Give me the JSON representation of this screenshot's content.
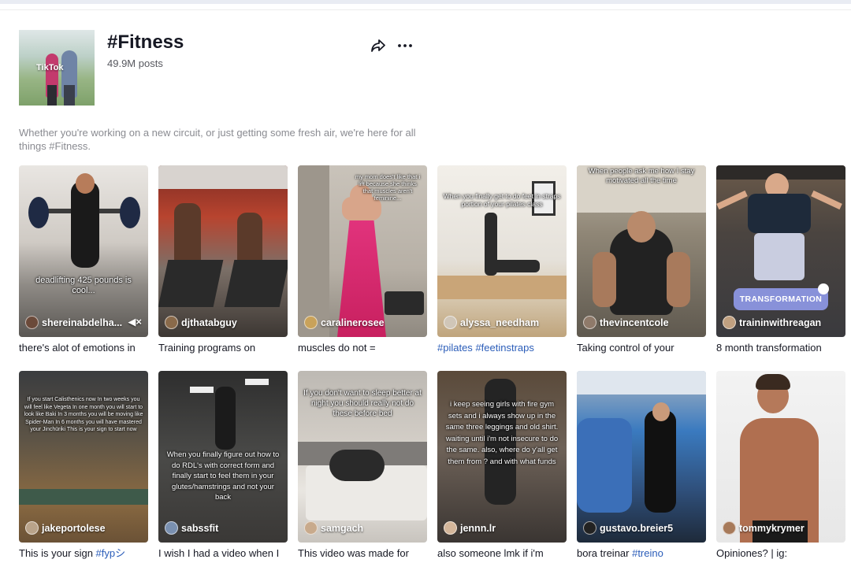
{
  "tag": {
    "title": "#Fitness",
    "posts": "49.9M posts",
    "description": "Whether you're working on a new circuit, or just getting some fresh air, we're here for all things #Fitness.",
    "cover_watermark": "TikTok"
  },
  "icons": {
    "share": "share-icon",
    "more": "more-icon",
    "mute": "mute-icon"
  },
  "colors": {
    "hashtag": "#2b5db9",
    "text": "#161823",
    "muted": "#8a8b91",
    "pill": "#8e98e6"
  },
  "videos": [
    {
      "author": "shereinabdelha...",
      "caption": "there's alot of emotions in",
      "overlay": "deadlifting 425 pounds is cool...",
      "muted": true
    },
    {
      "author": "djthatabguy",
      "caption": "Training programs on",
      "overlay": ""
    },
    {
      "author": "caralinerosee",
      "caption": "muscles do not =",
      "overlay": "my mom does't like that i lift because she thinks that muscles aren't feminine..."
    },
    {
      "author": "alyssa_needham",
      "caption": "#pilates #feetinstraps",
      "overlay": "When you finally get to do feet in straps portion of your pilates class"
    },
    {
      "author": "thevincentcole",
      "caption": "Taking control of your",
      "overlay": "When people ask me how I stay motivated all the time"
    },
    {
      "author": "traininwithreagan",
      "caption": "8 month transformation",
      "overlay": "",
      "pill": "TRANSFORMATION"
    },
    {
      "author": "jakeportolese",
      "caption": "This is your sign #fypシ",
      "overlay": "If you start Calisthenics now In two weeks you will feel like Vegeta In one month you will start to look like Baki In 3 months you will be moving like Spider-Man In 6 months you will have mastered your Jinchūriki This is your sign to start now"
    },
    {
      "author": "sabssfit",
      "caption": "I wish I had a video when I",
      "overlay": "When you finally figure out how to do RDL's with correct form and finally start to feel them in your glutes/hamstrings and not your back"
    },
    {
      "author": "samgach",
      "caption": "This video was made for",
      "overlay": "If you don't want to sleep better at night you should really not do these before bed"
    },
    {
      "author": "jennn.lr",
      "caption": "also someone lmk if i'm",
      "overlay": "i keep seeing girls with fire gym sets and i always show up in the same three leggings and old shirt. waiting until i'm not insecure to do the same. also, where do y'all get them from ? and with what funds"
    },
    {
      "author": "gustavo.breier5",
      "caption": "bora treinar #treino",
      "overlay": ""
    },
    {
      "author": "tommykrymer",
      "caption": "Opiniones? | ig:",
      "overlay": ""
    }
  ]
}
